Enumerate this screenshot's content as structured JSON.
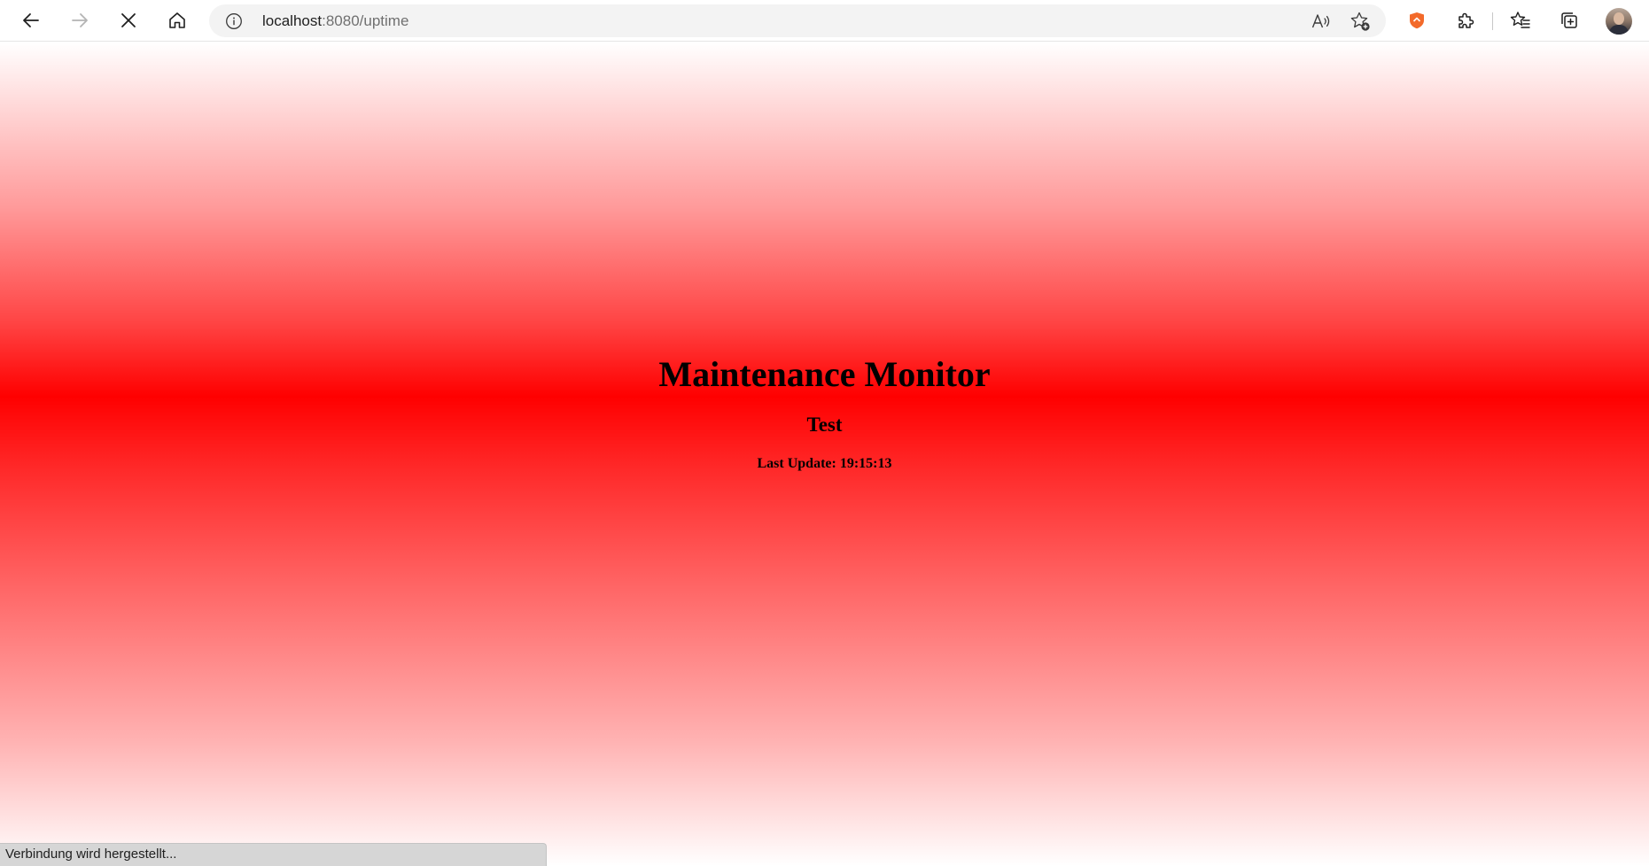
{
  "browser": {
    "address": {
      "host": "localhost",
      "rest": ":8080/uptime"
    },
    "icons": {
      "back": "back-arrow-icon",
      "forward": "forward-arrow-icon",
      "stop": "stop-loading-icon",
      "home": "home-icon",
      "site_info": "info-icon",
      "read_aloud": "read-aloud-icon",
      "add_favorite": "add-favorite-icon",
      "extension_shield": "shield-extension-icon",
      "extensions": "puzzle-extensions-icon",
      "favorites": "favorites-icon",
      "collections": "collections-icon",
      "profile": "profile-avatar"
    },
    "colors": {
      "shield_accent": "#f36a2a",
      "page_gradient_center": "#ff0000"
    },
    "status_text": "Verbindung wird hergestellt..."
  },
  "page": {
    "title": "Maintenance Monitor",
    "subtitle": "Test",
    "last_update": "Last Update: 19:15:13"
  }
}
